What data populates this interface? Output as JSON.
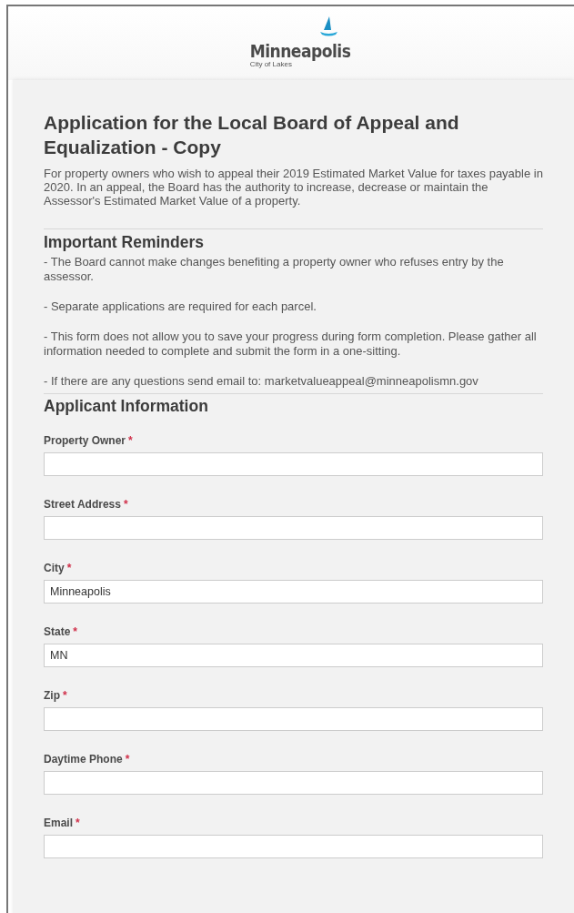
{
  "header": {
    "logo_name": "Minneapolis",
    "logo_tagline": "City of Lakes"
  },
  "form": {
    "title": "Application for the Local Board of Appeal and Equalization - Copy",
    "intro": "For property owners who wish to appeal their 2019 Estimated Market Value for taxes payable in 2020. In an appeal, the Board has the authority to increase, decrease or maintain the Assessor's Estimated Market Value of a property.",
    "reminders": {
      "heading": "Important Reminders",
      "items": [
        "- The Board cannot make changes benefiting a property owner who refuses entry by the assessor.",
        "- Separate applications are required for each parcel.",
        "- This form does not allow you to save your progress during form completion. Please gather all information needed to complete and submit the form in a one-sitting.",
        "- If there are any questions send email to: marketvalueappeal@minneapolismn.gov"
      ]
    },
    "section": "Applicant Information",
    "fields": [
      {
        "label": "Property Owner",
        "required_mark": "*"
      },
      {
        "label": "Street Address",
        "required_mark": "*"
      },
      {
        "label": "City",
        "required_mark": "*",
        "value": "Minneapolis"
      },
      {
        "label": "State",
        "required_mark": "*",
        "value": "MN"
      },
      {
        "label": "Zip",
        "required_mark": "*"
      },
      {
        "label": "Daytime Phone",
        "required_mark": "*"
      },
      {
        "label": "Email",
        "required_mark": "*"
      }
    ]
  }
}
